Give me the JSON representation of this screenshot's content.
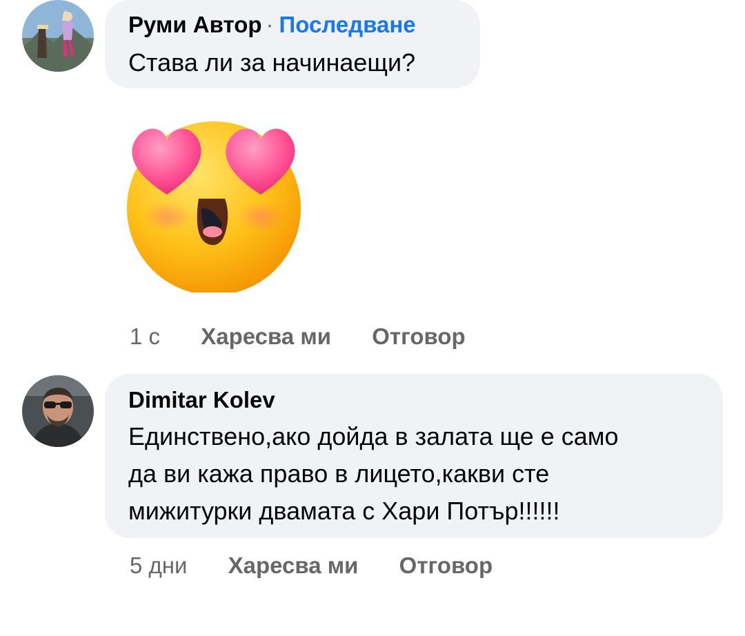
{
  "comments": [
    {
      "author": "Руми Автор",
      "separator": "·",
      "follow_label": "Последване",
      "text": "Става ли за начинаещи?",
      "sticker_icon": "heart-eyes-emoji",
      "time": "1 с",
      "like_label": "Харесва ми",
      "reply_label": "Отговор"
    },
    {
      "author": "Dimitar Kolev",
      "text_lines": [
        "Единствено,ако дойда в залата ще е само",
        "да ви кажа право в лицето,какви сте",
        "мижитурки двамата с Хари Потър!!!!!!"
      ],
      "time": "5 дни",
      "like_label": "Харесва ми",
      "reply_label": "Отговор"
    }
  ],
  "colors": {
    "bubble": "#f0f2f5",
    "link": "#1877f2",
    "meta": "#65676b",
    "text": "#050505"
  }
}
